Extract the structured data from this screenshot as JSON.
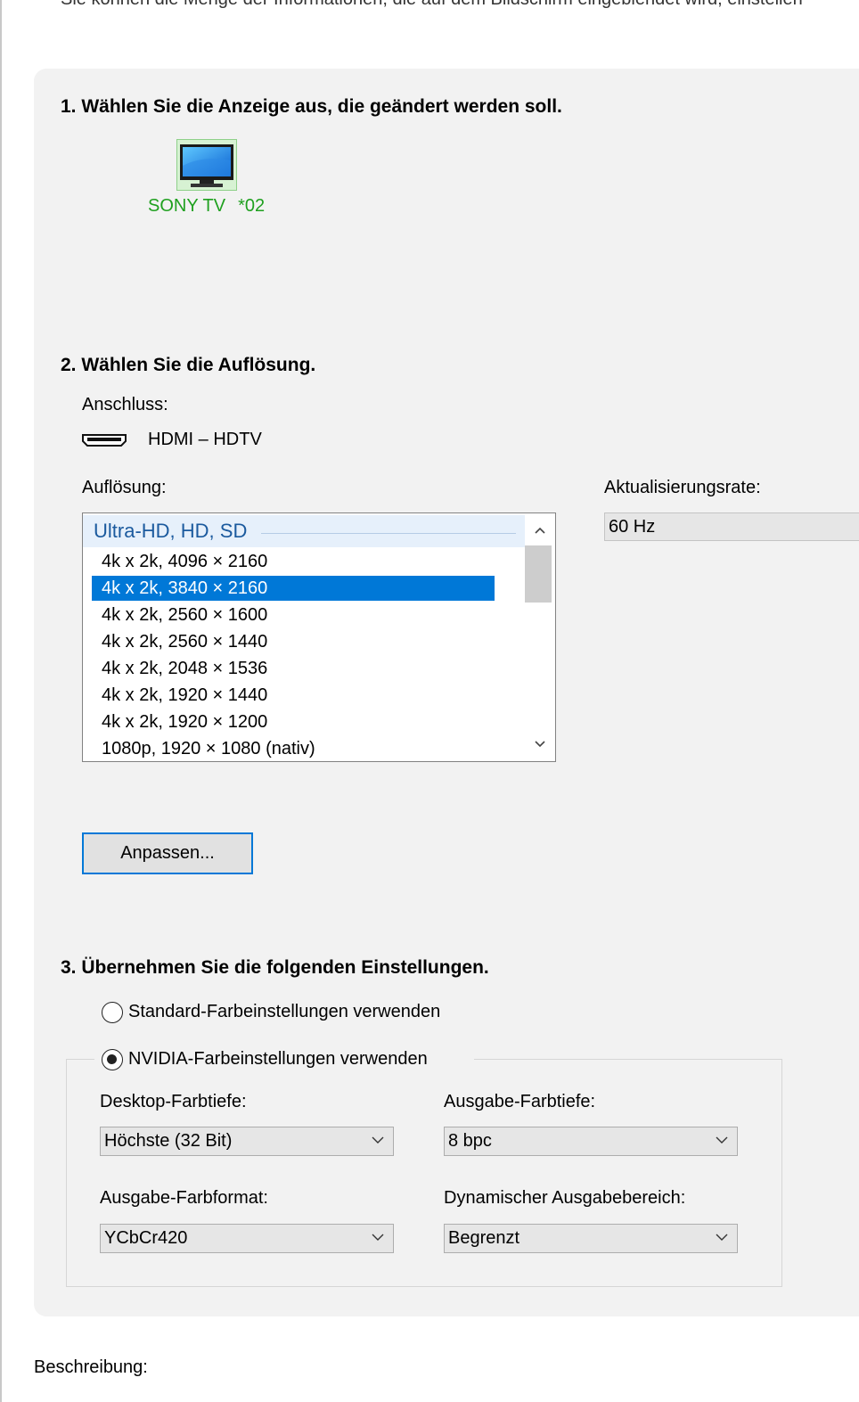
{
  "intro_text": "Sie können die Menge der Informationen, die auf dem Bildschirm eingeblendet wird, einstellen",
  "step1": {
    "heading": "1. Wählen Sie die Anzeige aus, die geändert werden soll.",
    "display": {
      "name": "SONY TV",
      "id": "*02",
      "icon": "monitor-icon"
    }
  },
  "step2": {
    "heading": "2. Wählen Sie die Auflösung.",
    "connector_label": "Anschluss:",
    "connector_value": "HDMI – HDTV",
    "connector_icon": "hdmi-icon",
    "resolution_label": "Auflösung:",
    "resolution_group": "Ultra-HD, HD, SD",
    "resolutions": [
      "4k x 2k, 4096 × 2160",
      "4k x 2k, 3840 × 2160",
      "4k x 2k, 2560 × 1600",
      "4k x 2k, 2560 × 1440",
      "4k x 2k, 2048 × 1536",
      "4k x 2k, 1920 × 1440",
      "4k x 2k, 1920 × 1200",
      "1080p, 1920 × 1080 (nativ)"
    ],
    "selected_resolution": "4k x 2k, 3840 × 2160",
    "refresh_label": "Aktualisierungsrate:",
    "refresh_value": "60 Hz",
    "customize_button": "Anpassen..."
  },
  "step3": {
    "heading": "3. Übernehmen Sie die folgenden Einstellungen.",
    "radio_default": "Standard-Farbeinstellungen verwenden",
    "radio_nvidia": "NVIDIA-Farbeinstellungen verwenden",
    "selected_radio": "NVIDIA-Farbeinstellungen verwenden",
    "desktop_depth_label": "Desktop-Farbtiefe:",
    "desktop_depth_value": "Höchste (32 Bit)",
    "output_depth_label": "Ausgabe-Farbtiefe:",
    "output_depth_value": "8 bpc",
    "output_format_label": "Ausgabe-Farbformat:",
    "output_format_value": "YCbCr420",
    "dynamic_range_label": "Dynamischer Ausgabebereich:",
    "dynamic_range_value": "Begrenzt"
  },
  "description_label": "Beschreibung:",
  "colors": {
    "accent": "#0078d7",
    "display_green": "#1fa01f",
    "panel_bg": "#f2f2f2"
  }
}
